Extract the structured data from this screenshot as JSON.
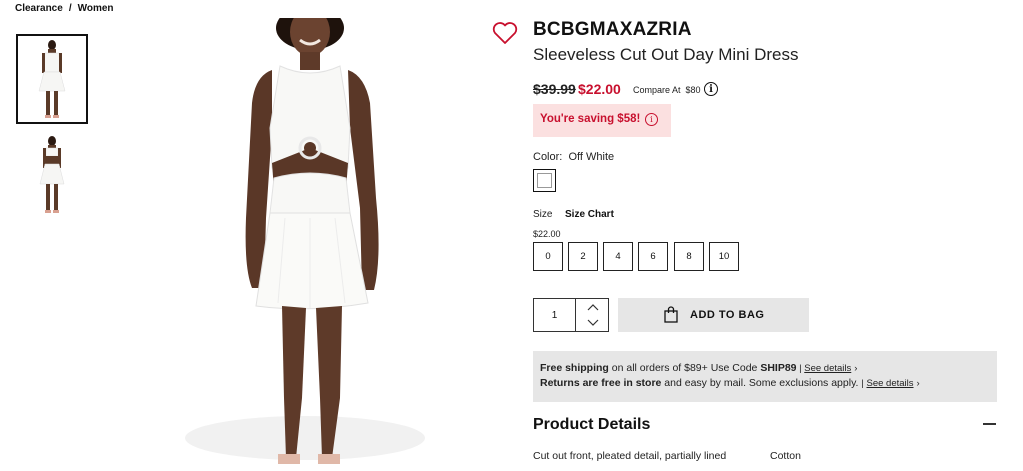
{
  "breadcrumb": {
    "items": [
      "Clearance",
      "Women"
    ],
    "separator": "/"
  },
  "product": {
    "brand": "BCBGMAXAZRIA",
    "name": "Sleeveless Cut Out Day Mini Dress",
    "was_price": "$39.99",
    "price": "$22.00",
    "compare_label": "Compare At",
    "compare_price": "$80",
    "saving_text": "You're saving $58!"
  },
  "color": {
    "label": "Color:",
    "value": "Off White"
  },
  "size": {
    "label": "Size",
    "chart_label": "Size Chart",
    "price": "$22.00",
    "options": [
      "0",
      "2",
      "4",
      "6",
      "8",
      "10"
    ]
  },
  "cart": {
    "quantity": "1",
    "add_label": "ADD TO BAG"
  },
  "shipping": {
    "line1_bold": "Free shipping",
    "line1_rest": " on all orders of $89+ Use Code ",
    "line1_code": "SHIP89",
    "line1_sep": " | ",
    "line2_bold": "Returns are free in store",
    "line2_rest": " and easy by mail. Some exclusions apply. ",
    "line2_sep": "| ",
    "see_details": "See details",
    "chevron": "›"
  },
  "details": {
    "title": "Product Details",
    "line1": "Cut out front, pleated detail, partially lined",
    "line2": "Cotton"
  },
  "colors": {
    "sale_red": "#c8102e",
    "saving_bg": "#fbe0e0",
    "button_gray": "#e6e6e6"
  },
  "icons": [
    "heart-icon",
    "info-icon",
    "chevron-up-icon",
    "chevron-down-icon",
    "shopping-bag-icon",
    "minus-icon"
  ]
}
